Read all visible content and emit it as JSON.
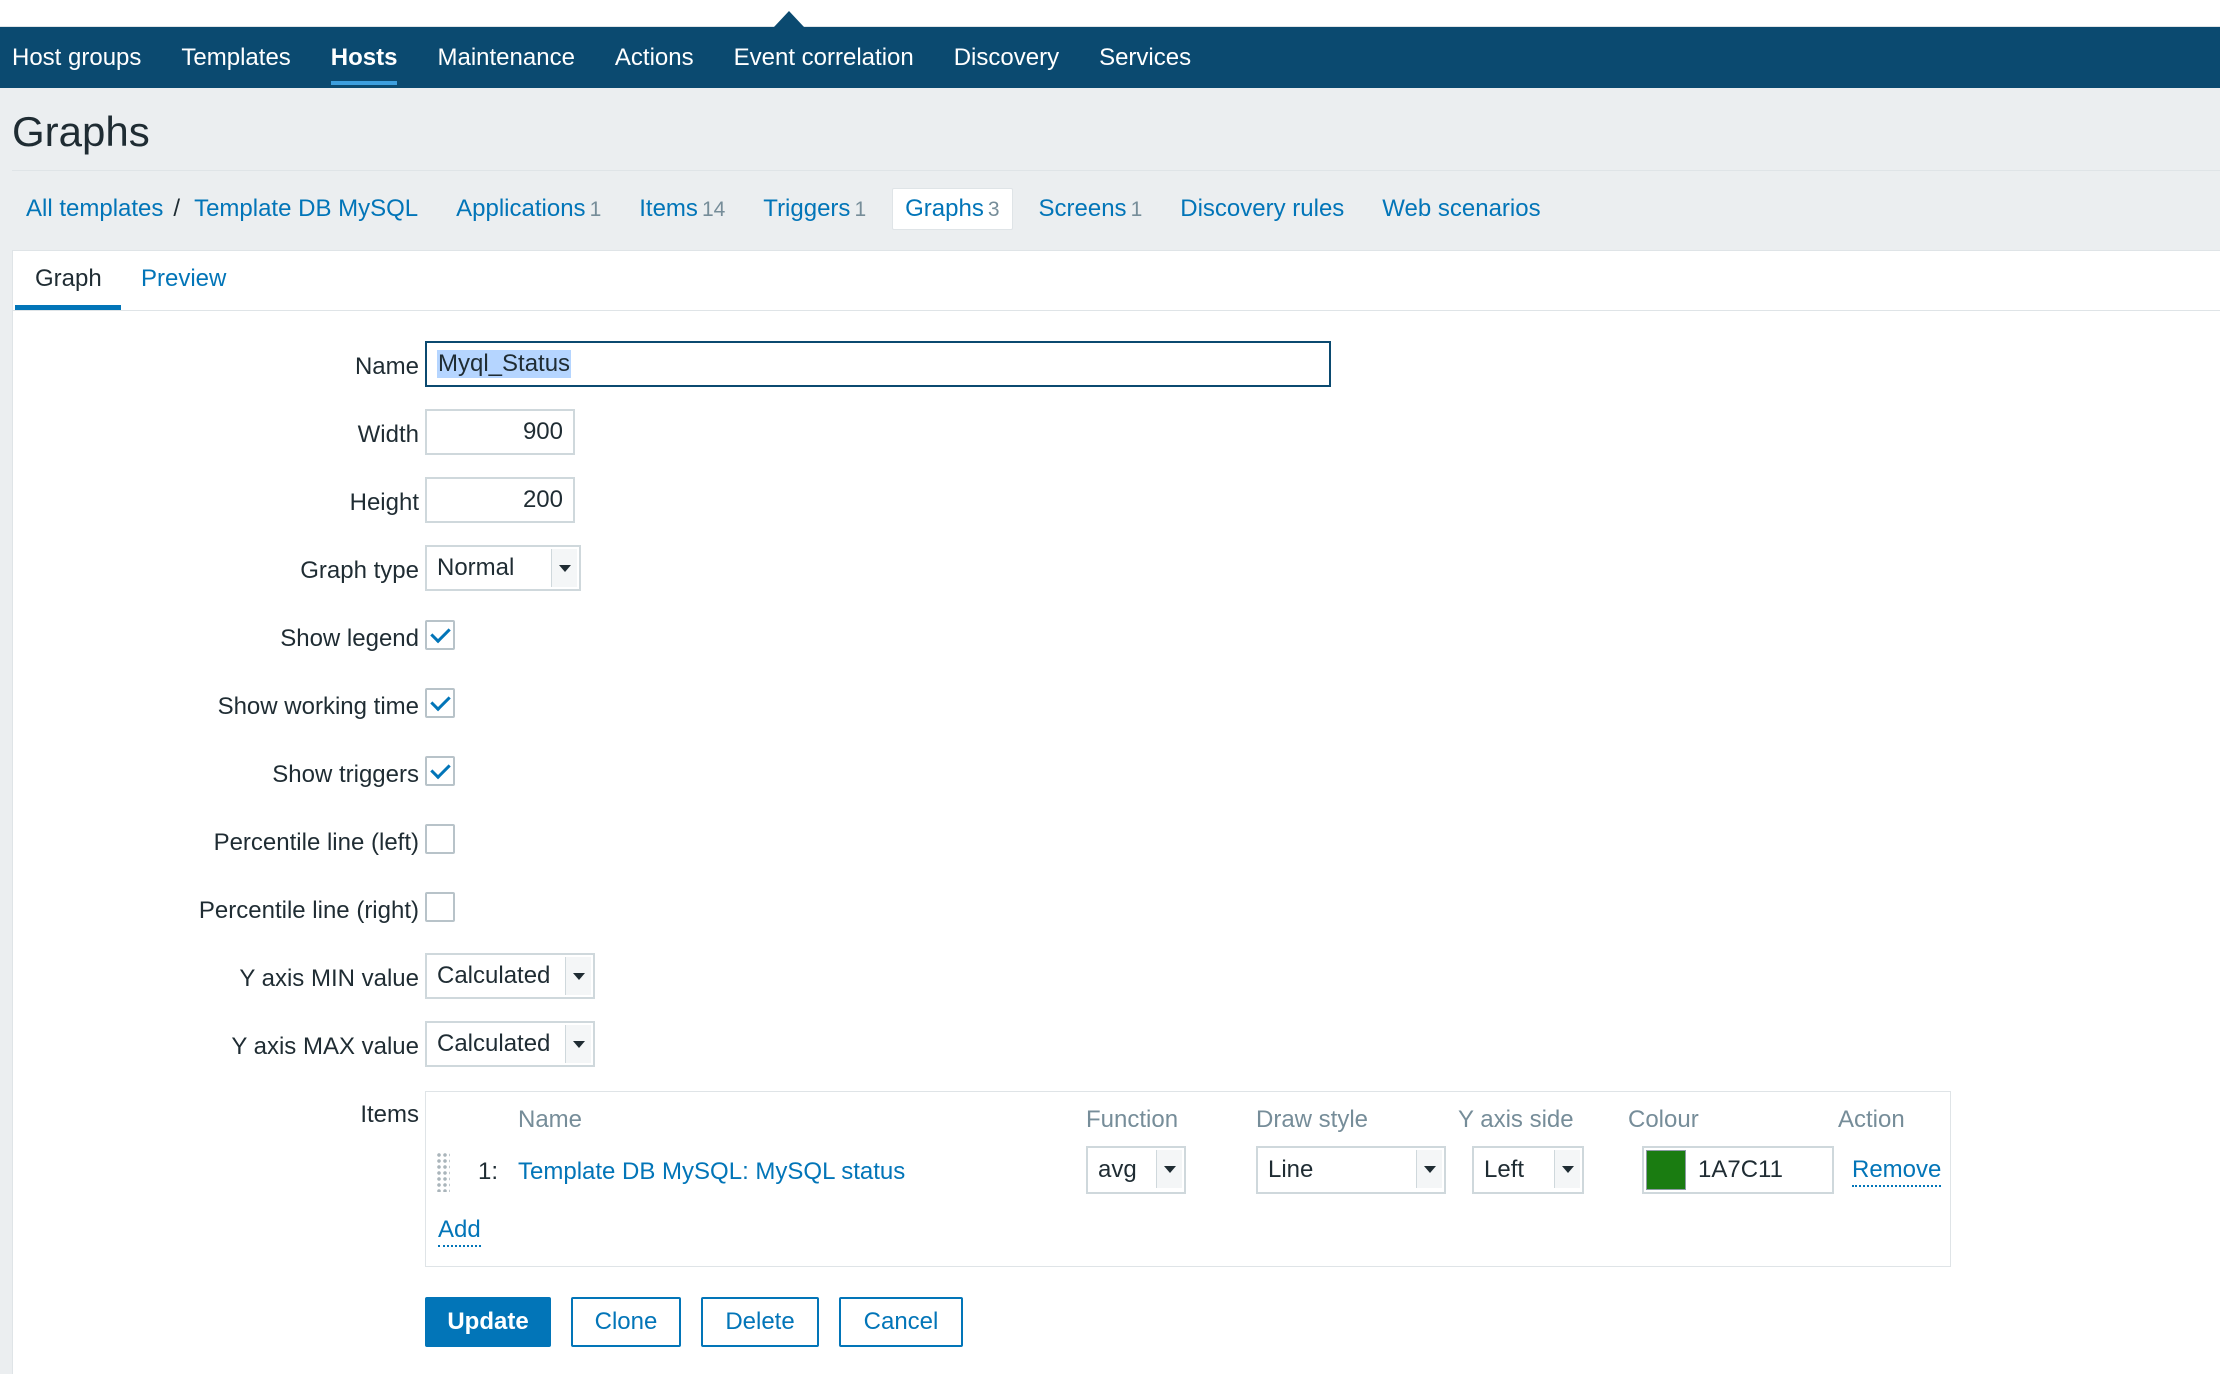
{
  "top_nav": [
    {
      "label": "Host groups",
      "active": false
    },
    {
      "label": "Templates",
      "active": false
    },
    {
      "label": "Hosts",
      "active": true
    },
    {
      "label": "Maintenance",
      "active": false
    },
    {
      "label": "Actions",
      "active": false
    },
    {
      "label": "Event correlation",
      "active": false
    },
    {
      "label": "Discovery",
      "active": false
    },
    {
      "label": "Services",
      "active": false
    }
  ],
  "page_title": "Graphs",
  "breadcrumb": {
    "all_templates": "All templates",
    "separator": "/",
    "template": "Template DB MySQL",
    "links": [
      {
        "label": "Applications",
        "count": "1"
      },
      {
        "label": "Items",
        "count": "14"
      },
      {
        "label": "Triggers",
        "count": "1"
      },
      {
        "label": "Graphs",
        "count": "3",
        "active": true
      },
      {
        "label": "Screens",
        "count": "1"
      },
      {
        "label": "Discovery rules",
        "count": ""
      },
      {
        "label": "Web scenarios",
        "count": ""
      }
    ]
  },
  "tabs": {
    "graph": "Graph",
    "preview": "Preview"
  },
  "form": {
    "name_label": "Name",
    "name_value": "Myql_Status",
    "width_label": "Width",
    "width_value": "900",
    "height_label": "Height",
    "height_value": "200",
    "graph_type_label": "Graph type",
    "graph_type_value": "Normal",
    "show_legend_label": "Show legend",
    "show_legend": true,
    "show_working_time_label": "Show working time",
    "show_working_time": true,
    "show_triggers_label": "Show triggers",
    "show_triggers": true,
    "percentile_left_label": "Percentile line (left)",
    "percentile_left": false,
    "percentile_right_label": "Percentile line (right)",
    "percentile_right": false,
    "ymin_label": "Y axis MIN value",
    "ymin_value": "Calculated",
    "ymax_label": "Y axis MAX value",
    "ymax_value": "Calculated",
    "items_label": "Items"
  },
  "items_table": {
    "headers": {
      "name": "Name",
      "function": "Function",
      "draw_style": "Draw style",
      "y_axis_side": "Y axis side",
      "colour": "Colour",
      "action": "Action"
    },
    "rows": [
      {
        "num": "1:",
        "name": "Template DB MySQL: MySQL status",
        "function": "avg",
        "draw_style": "Line",
        "y_axis_side": "Left",
        "colour": "1A7C11",
        "colour_hex": "#1A7C11",
        "action": "Remove"
      }
    ],
    "add_label": "Add"
  },
  "buttons": {
    "update": "Update",
    "clone": "Clone",
    "delete": "Delete",
    "cancel": "Cancel"
  },
  "colors": {
    "nav_bg": "#0b4a70",
    "link": "#0275b8",
    "page_bg": "#ebeef0"
  }
}
